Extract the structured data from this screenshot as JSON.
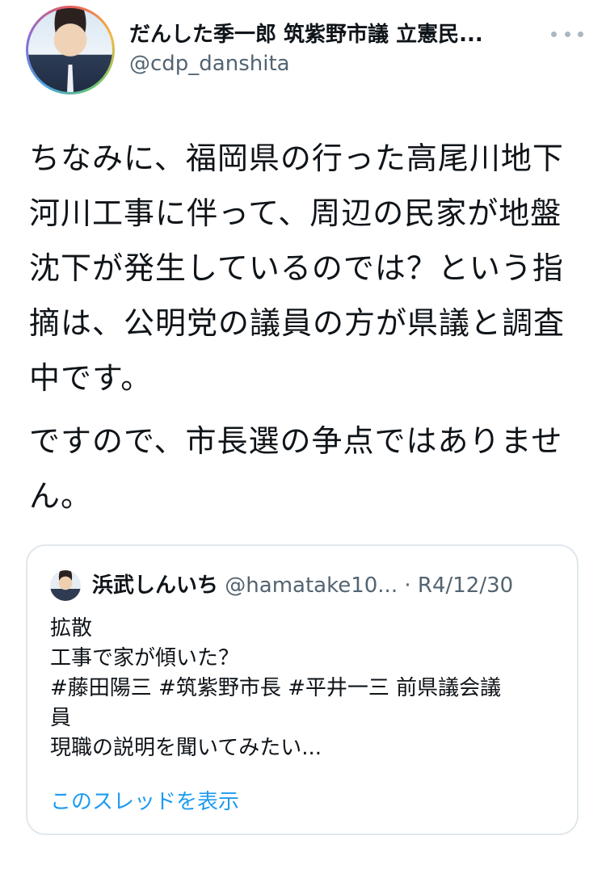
{
  "author": {
    "display_name": "だんした季一郎 筑紫野市議 立憲民...",
    "handle": "@cdp_danshita"
  },
  "tweet": {
    "paragraphs": [
      "ちなみに、福岡県の行った高尾川地下河川工事に伴って、周辺の民家が地盤沈下が発生しているのでは？という指摘は、公明党の議員の方が県議と調査中です。",
      "ですので、市長選の争点ではありません。"
    ]
  },
  "quoted": {
    "name": "浜武しんいち",
    "handle": "@hamatake10...",
    "separator": "·",
    "date": "R4/12/30",
    "lines": [
      "拡散",
      "工事で家が傾いた？",
      "#藤田陽三 #筑紫野市長 #平井一三 前県議会議",
      "員",
      "現職の説明を聞いてみたい..."
    ],
    "show_thread_label": "このスレッドを表示"
  },
  "icons": {
    "more": "more-dots-icon"
  },
  "colors": {
    "text": "#0f1419",
    "secondary": "#536471",
    "link": "#1d9bf0",
    "border": "#e1e8ed"
  }
}
